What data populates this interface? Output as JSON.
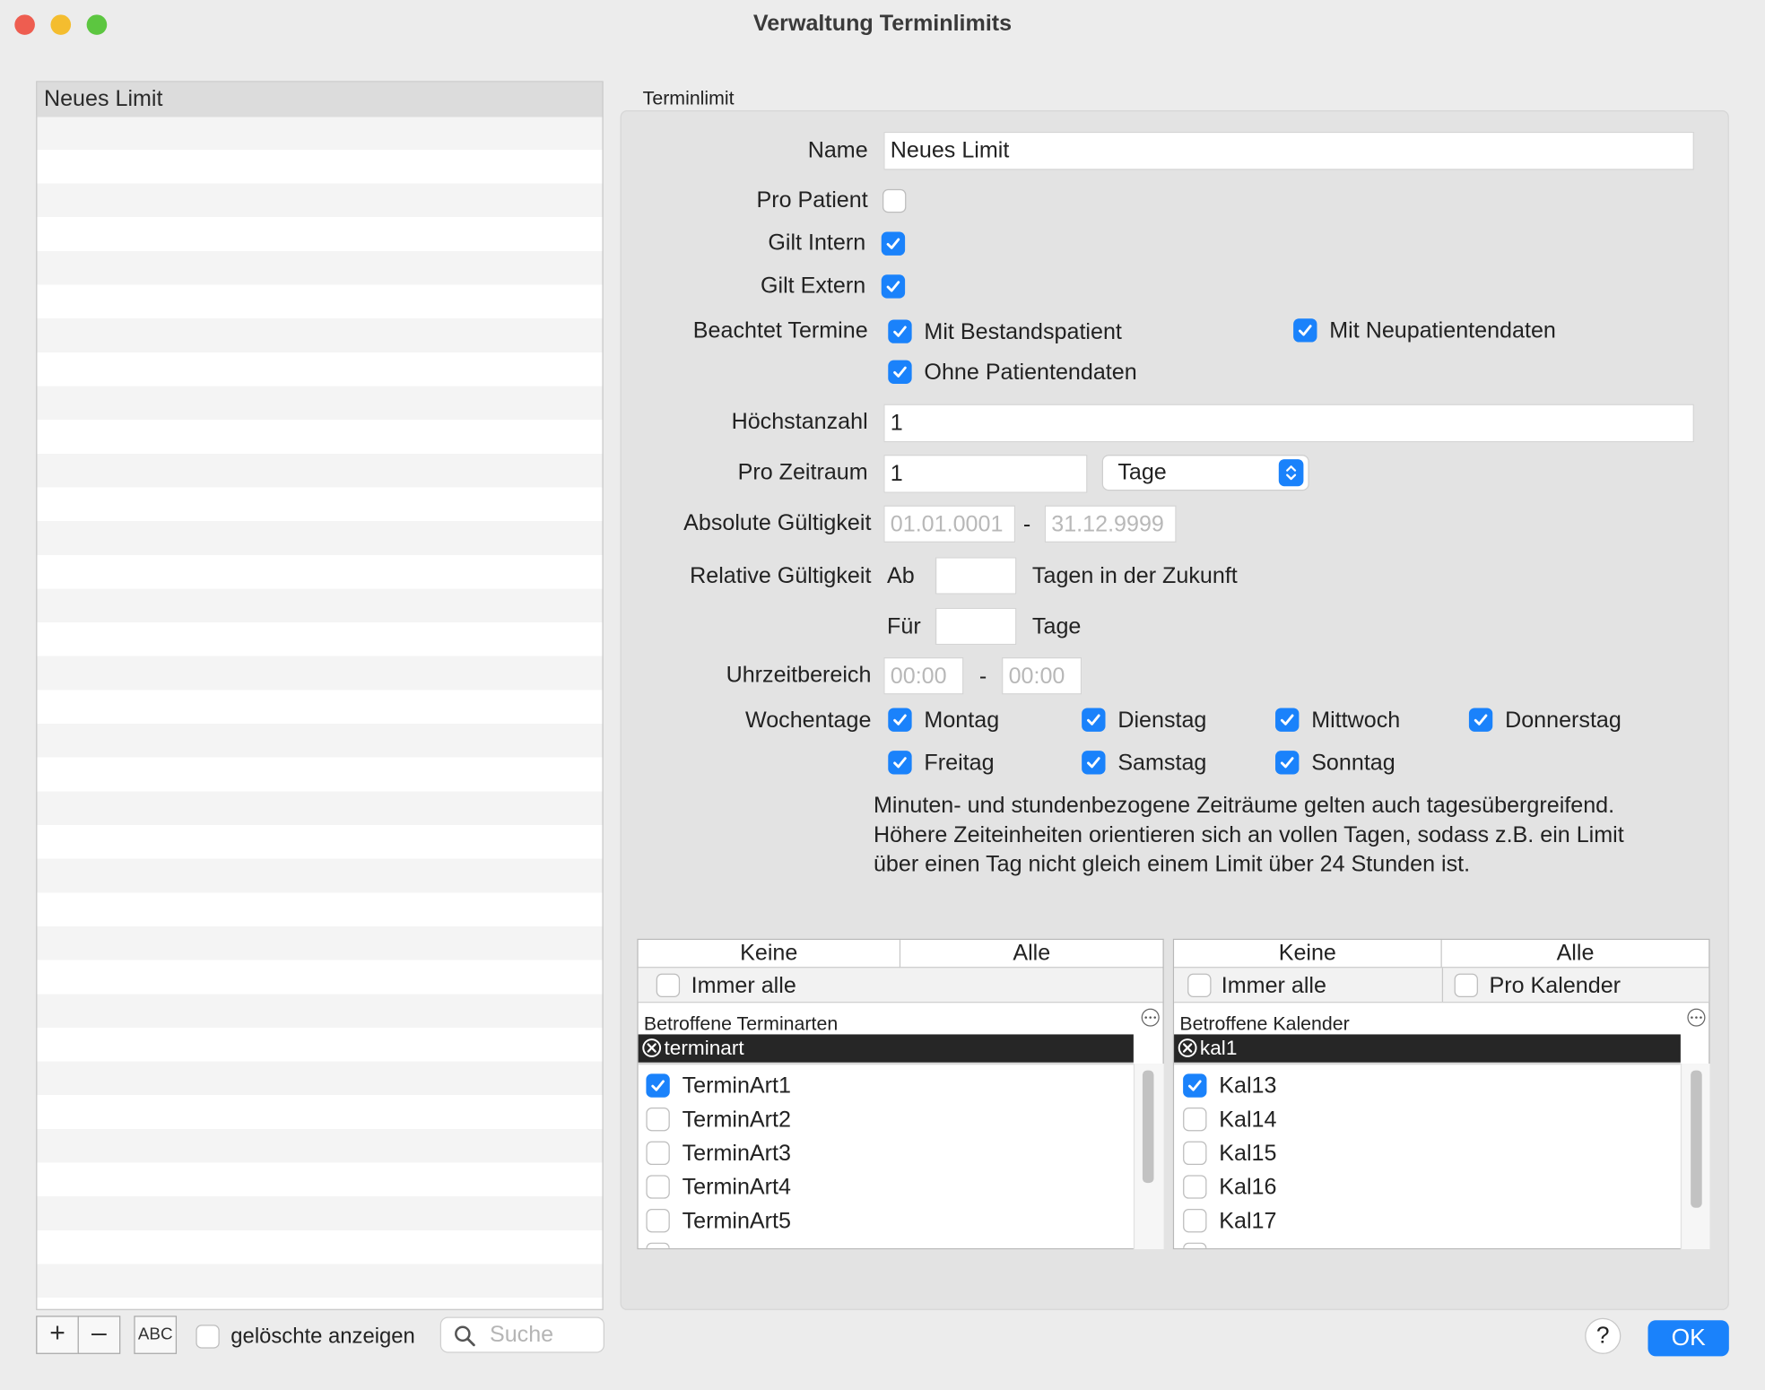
{
  "window": {
    "title": "Verwaltung Terminlimits"
  },
  "sidebar": {
    "items": [
      "Neues Limit"
    ],
    "add_button": "+",
    "remove_button": "–",
    "sort_button": "ABC",
    "show_deleted_label": "gelöschte anzeigen",
    "show_deleted_checked": false,
    "search_placeholder": "Suche"
  },
  "form": {
    "group_title": "Terminlimit",
    "name": {
      "label": "Name",
      "value": "Neues Limit"
    },
    "pro_patient": {
      "label": "Pro Patient",
      "checked": false
    },
    "gilt_intern": {
      "label": "Gilt Intern",
      "checked": true
    },
    "gilt_extern": {
      "label": "Gilt Extern",
      "checked": true
    },
    "beachtet": {
      "label": "Beachtet Termine",
      "mit_bestandspatient": "Mit Bestandspatient",
      "mit_neupatientendaten": "Mit Neupatientendaten",
      "ohne_patientendaten": "Ohne Patientendaten"
    },
    "hoechstanzahl": {
      "label": "Höchstanzahl",
      "value": "1"
    },
    "pro_zeitraum": {
      "label": "Pro Zeitraum",
      "value": "1",
      "unit": "Tage"
    },
    "absolute_gueltigkeit": {
      "label": "Absolute Gültigkeit",
      "from": "01.01.0001",
      "separator": "-",
      "to": "31.12.9999"
    },
    "relative_gueltigkeit": {
      "label": "Relative Gültigkeit",
      "ab_label": "Ab",
      "ab_suffix": "Tagen in der Zukunft",
      "fuer_label": "Für",
      "fuer_suffix": "Tage"
    },
    "uhrzeitbereich": {
      "label": "Uhrzeitbereich",
      "from": "00:00",
      "separator": "-",
      "to": "00:00"
    },
    "wochentage": {
      "label": "Wochentage",
      "days": [
        "Montag",
        "Dienstag",
        "Mittwoch",
        "Donnerstag",
        "Freitag",
        "Samstag",
        "Sonntag"
      ]
    },
    "note_lines": [
      "Minuten- und stundenbezogene Zeiträume gelten auch tagesübergreifend.",
      "Höhere Zeiteinheiten orientieren sich an vollen Tagen, sodass z.B. ein Limit",
      "über einen Tag nicht gleich einem Limit über 24 Stunden ist."
    ]
  },
  "terminarten": {
    "header_none": "Keine",
    "header_all": "Alle",
    "immer_alle": "Immer alle",
    "section_title": "Betroffene Terminarten",
    "filter": "terminart",
    "items": [
      {
        "label": "TerminArt1",
        "checked": true
      },
      {
        "label": "TerminArt2",
        "checked": false
      },
      {
        "label": "TerminArt3",
        "checked": false
      },
      {
        "label": "TerminArt4",
        "checked": false
      },
      {
        "label": "TerminArt5",
        "checked": false
      }
    ]
  },
  "kalender": {
    "header_none": "Keine",
    "header_all": "Alle",
    "immer_alle": "Immer alle",
    "pro_kalender": "Pro Kalender",
    "section_title": "Betroffene Kalender",
    "filter": "kal1",
    "items": [
      {
        "label": "Kal13",
        "checked": true
      },
      {
        "label": "Kal14",
        "checked": false
      },
      {
        "label": "Kal15",
        "checked": false
      },
      {
        "label": "Kal16",
        "checked": false
      },
      {
        "label": "Kal17",
        "checked": false
      }
    ]
  },
  "footer": {
    "help": "?",
    "ok": "OK"
  },
  "colors": {
    "accent": "#1a82fb",
    "close": "#ee5d50",
    "minimize": "#f4bd2f",
    "zoom": "#5cc640"
  }
}
